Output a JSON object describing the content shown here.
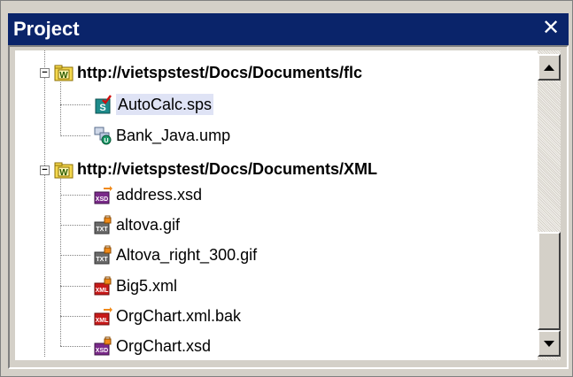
{
  "panel": {
    "title": "Project",
    "close_glyph": "✕"
  },
  "tree": {
    "folders": [
      {
        "label": "http://vietspstest/Docs/Documents/flc",
        "icon": "web-folder-icon",
        "expanded": true,
        "files": [
          {
            "label": "AutoCalc.sps",
            "icon": "sps-file-icon",
            "selected": true
          },
          {
            "label": "Bank_Java.ump",
            "icon": "ump-file-icon",
            "selected": false
          }
        ]
      },
      {
        "label": "http://vietspstest/Docs/Documents/XML",
        "icon": "web-folder-icon",
        "expanded": true,
        "files": [
          {
            "label": "address.xsd",
            "icon": "xsd-file-icon",
            "selected": false
          },
          {
            "label": "altova.gif",
            "icon": "txt-file-icon",
            "selected": false
          },
          {
            "label": "Altova_right_300.gif",
            "icon": "txt-file-icon",
            "selected": false
          },
          {
            "label": "Big5.xml",
            "icon": "xml-file-icon",
            "selected": false
          },
          {
            "label": "OrgChart.xml.bak",
            "icon": "xml-file-icon",
            "selected": false
          },
          {
            "label": "OrgChart.xsd",
            "icon": "xsd-file-icon",
            "selected": false
          }
        ]
      }
    ]
  },
  "colors": {
    "title_bar": "#0a246a",
    "selection": "#dfe3f5",
    "panel_bg": "#d4d0c8"
  }
}
